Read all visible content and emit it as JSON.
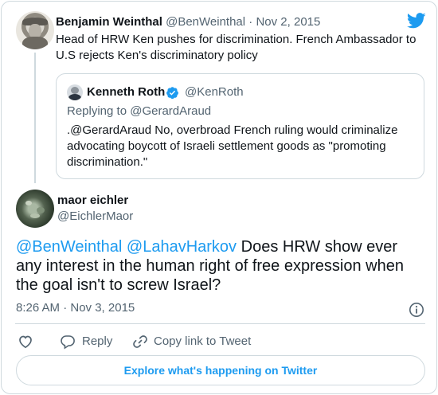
{
  "parent_tweet": {
    "name": "Benjamin Weinthal",
    "handle": "@BenWeinthal",
    "separator": "·",
    "date": "Nov 2, 2015",
    "text": "Head of HRW Ken pushes for discrimination. French Ambassador to U.S rejects Ken's discriminatory policy"
  },
  "quoted_tweet": {
    "name": "Kenneth Roth",
    "handle": "@KenRoth",
    "replying_to": "Replying to @GerardAraud",
    "text": ".@GerardAraud No, overbroad French ruling would criminalize advocating boycott of Israeli settlement goods as \"promoting discrimination.\""
  },
  "main_tweet": {
    "name": "maor eichler",
    "handle": "@EichlerMaor",
    "mention_1": "@BenWeinthal",
    "mention_2": "@LahavHarkov",
    "text": "Does HRW show ever any interest in the human right of free expression when the goal isn't to screw Israel?",
    "timestamp": "8:26 AM · Nov 3, 2015"
  },
  "actions": {
    "reply_label": "Reply",
    "copy_link_label": "Copy link to Tweet"
  },
  "explore_label": "Explore what's happening on Twitter",
  "icons": {
    "brand": "twitter-bird-icon",
    "verified": "verified-badge-icon",
    "info": "info-icon",
    "like": "heart-icon",
    "reply": "reply-bubble-icon",
    "copy_link": "link-icon"
  },
  "colors": {
    "accent": "#1d9bf0",
    "text": "#0f1419",
    "muted": "#536471",
    "border": "#cfd9de"
  }
}
